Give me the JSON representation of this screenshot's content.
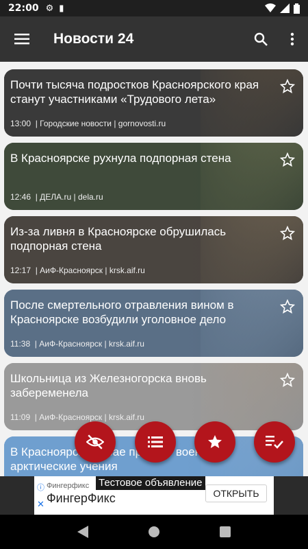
{
  "status_bar": {
    "time": "22:00"
  },
  "app": {
    "title": "Новости 24"
  },
  "news": [
    {
      "headline": "Почти тысяча подростков Красноярского края станут участниками «Трудового лета»",
      "time": "13:00",
      "source": "Городские новости",
      "domain": "gornovosti.ru",
      "bg": "#3a3a3a",
      "photo": "#6b5a45"
    },
    {
      "headline": "В Красноярске рухнула подпорная стена",
      "time": "12:46",
      "source": "ДЕЛА.ru",
      "domain": "dela.ru",
      "bg": "#3f4a3a",
      "photo": "#7a7f5a"
    },
    {
      "headline": "Из-за ливня в Красноярске обрушилась подпорная стена",
      "time": "12:17",
      "source": "АиФ-Красноярск",
      "domain": "krsk.aif.ru",
      "bg": "#4a4540",
      "photo": "#8a7a60"
    },
    {
      "headline": "После смертельного отравления вином в Красноярске возбудили уголовное дело",
      "time": "11:38",
      "source": "АиФ-Красноярск",
      "domain": "krsk.aif.ru",
      "bg": "#5a6f86",
      "photo": "#8aa0b8"
    },
    {
      "headline": "Школьница из Железногорска вновь забеременела",
      "time": "11:09",
      "source": "АиФ-Красноярск",
      "domain": "krsk.aif.ru",
      "bg": "#9a9a9a",
      "photo": "#b0a090"
    },
    {
      "headline": "В Красноярском крае пройдут военные арктические учения",
      "time": "",
      "source": "",
      "domain": "",
      "bg": "#6f9fcf",
      "photo": "#8ab0d8"
    }
  ],
  "ad": {
    "label": "Тестовое объявление",
    "small_text": "Фингерфикс",
    "name": "ФингерФикс",
    "button": "ОТКРЫТЬ"
  },
  "fabs": [
    "hide-icon",
    "list-icon",
    "star-icon",
    "checklist-icon"
  ],
  "colors": {
    "accent": "#b3151c",
    "appbar": "#333333"
  }
}
